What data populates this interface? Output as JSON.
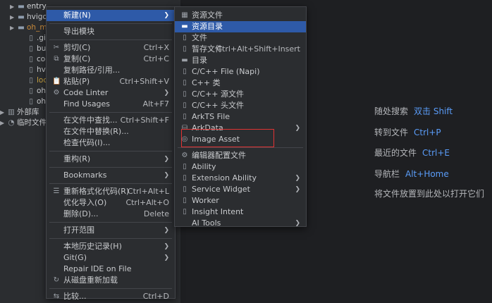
{
  "project_tree": [
    {
      "label": "entry",
      "color": "#d5d7da",
      "arrow": "▶",
      "icon": "folder-icon"
    },
    {
      "label": "hvigo",
      "color": "#c8cacd",
      "arrow": "▶",
      "icon": "folder-icon"
    },
    {
      "label": "oh_m",
      "color": "#c98a3a",
      "arrow": "▶",
      "icon": "folder-icon"
    },
    {
      "label": ".gitig",
      "color": "#c8cacd",
      "arrow": "",
      "icon": "file-icon"
    },
    {
      "label": "build",
      "color": "#c8cacd",
      "arrow": "",
      "icon": "file-icon"
    },
    {
      "label": "code-",
      "color": "#c8cacd",
      "arrow": "",
      "icon": "file-icon"
    },
    {
      "label": "hvigo",
      "color": "#c8cacd",
      "arrow": "",
      "icon": "file-icon"
    },
    {
      "label": "local.",
      "color": "#c9a341",
      "arrow": "",
      "icon": "file-icon"
    },
    {
      "label": "oh-pa",
      "color": "#c8cacd",
      "arrow": "",
      "icon": "file-icon"
    },
    {
      "label": "oh-pa",
      "color": "#c8cacd",
      "arrow": "",
      "icon": "file-icon"
    },
    {
      "label": "外部库",
      "color": "#c8cacd",
      "arrow": "▶",
      "icon": "library-icon"
    },
    {
      "label": "临时文件",
      "color": "#c8cacd",
      "arrow": "▶",
      "icon": "scratch-icon"
    }
  ],
  "context_menu": [
    {
      "label": "新建(N)",
      "submenu": true,
      "highlight": true
    },
    {
      "sep": true
    },
    {
      "label": "导出模块"
    },
    {
      "sep": true
    },
    {
      "label": "剪切(C)",
      "icon": "✂",
      "shortcut": "Ctrl+X"
    },
    {
      "label": "复制(C)",
      "icon": "⧉",
      "shortcut": "Ctrl+C"
    },
    {
      "label": "复制路径/引用..."
    },
    {
      "label": "粘贴(P)",
      "icon": "📋",
      "shortcut": "Ctrl+Shift+V"
    },
    {
      "label": "Code Linter",
      "icon": "⚙",
      "submenu": true
    },
    {
      "label": "Find Usages",
      "shortcut": "Alt+F7"
    },
    {
      "sep": true
    },
    {
      "label": "在文件中查找...",
      "shortcut": "Ctrl+Shift+F"
    },
    {
      "label": "在文件中替换(R)..."
    },
    {
      "label": "检查代码(I)..."
    },
    {
      "sep": true
    },
    {
      "label": "重构(R)",
      "submenu": true
    },
    {
      "sep": true
    },
    {
      "label": "Bookmarks",
      "submenu": true
    },
    {
      "sep": true
    },
    {
      "label": "重新格式化代码(R)",
      "icon": "☰",
      "shortcut": "Ctrl+Alt+L"
    },
    {
      "label": "优化导入(O)",
      "shortcut": "Ctrl+Alt+O"
    },
    {
      "label": "删除(D)...",
      "shortcut": "Delete"
    },
    {
      "sep": true
    },
    {
      "label": "打开范围",
      "submenu": true
    },
    {
      "sep": true
    },
    {
      "label": "本地历史记录(H)",
      "submenu": true
    },
    {
      "label": "Git(G)",
      "submenu": true
    },
    {
      "label": "Repair IDE on File"
    },
    {
      "label": "从磁盘重新加载",
      "icon": "↻"
    },
    {
      "sep": true
    },
    {
      "label": "比较...",
      "icon": "⇆",
      "shortcut": "Ctrl+D"
    }
  ],
  "new_submenu": [
    {
      "label": "资源文件",
      "icon": "▦"
    },
    {
      "label": "资源目录",
      "icon": "▬",
      "highlight": true
    },
    {
      "label": "文件",
      "icon": "▯"
    },
    {
      "label": "暂存文件",
      "icon": "▯",
      "shortcut": "Ctrl+Alt+Shift+Insert"
    },
    {
      "label": "目录",
      "icon": "▬"
    },
    {
      "label": "C/C++ File (Napi)",
      "icon": "▯"
    },
    {
      "label": "C++ 类",
      "icon": "▯"
    },
    {
      "label": "C/C++ 源文件",
      "icon": "▯"
    },
    {
      "label": "C/C++ 头文件",
      "icon": "▯"
    },
    {
      "label": "ArkTS File",
      "icon": "▯"
    },
    {
      "label": "ArkData",
      "icon": "⛁",
      "submenu": true
    },
    {
      "label": "Image Asset",
      "icon": "◎"
    },
    {
      "sep": true
    },
    {
      "label": "编辑器配置文件",
      "icon": "⚙"
    },
    {
      "label": "Ability",
      "icon": "▯"
    },
    {
      "label": "Extension Ability",
      "icon": "▯",
      "submenu": true
    },
    {
      "label": "Service Widget",
      "icon": "▯",
      "submenu": true
    },
    {
      "label": "Worker",
      "icon": "▯"
    },
    {
      "label": "Insight Intent",
      "icon": "▯"
    },
    {
      "label": "AI Tools",
      "icon": "",
      "submenu": true
    }
  ],
  "hints": [
    {
      "label": "随处搜索",
      "key": "双击 Shift"
    },
    {
      "label": "转到文件",
      "key": "Ctrl+P"
    },
    {
      "label": "最近的文件",
      "key": "Ctrl+E"
    },
    {
      "label": "导航栏",
      "key": "Alt+Home"
    },
    {
      "label": "将文件放置到此处以打开它们",
      "key": ""
    }
  ],
  "colors": {
    "accent": "#2e5aa8",
    "link": "#5a9cf8",
    "highlight_box": "#e13333"
  }
}
